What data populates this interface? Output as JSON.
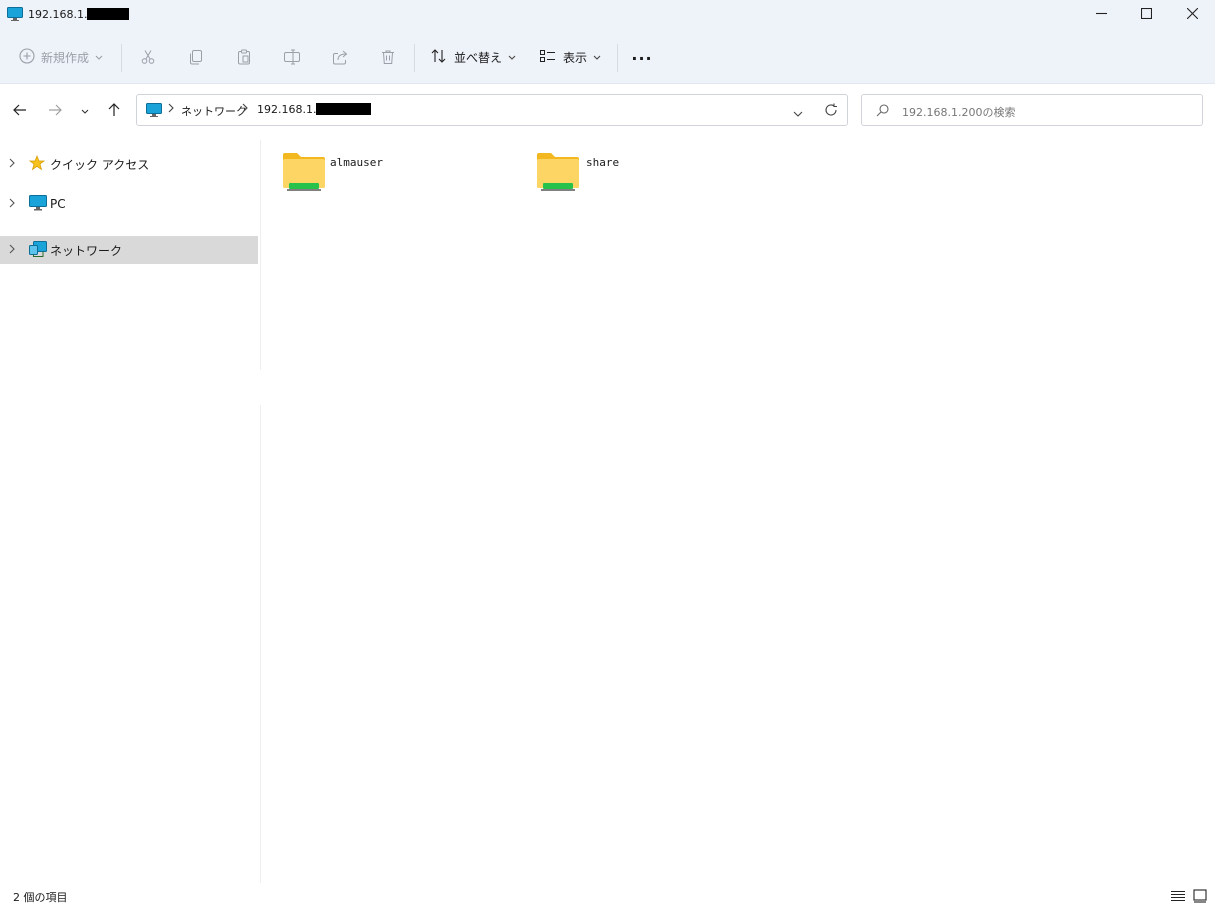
{
  "window": {
    "title": "192.168.1.",
    "minimize_icon": "minimize-icon",
    "maximize_icon": "maximize-icon",
    "close_icon": "close-icon"
  },
  "toolbar": {
    "new_label": "新規作成",
    "sort_label": "並べ替え",
    "view_label": "表示",
    "more_label": "···"
  },
  "nav": {
    "breadcrumb": [
      "ネットワーク",
      "192.168.1."
    ],
    "search_placeholder": "192.168.1.200の検索"
  },
  "sidebar": {
    "items": [
      {
        "label": "クイック アクセス",
        "icon": "star-icon"
      },
      {
        "label": "PC",
        "icon": "pc-icon"
      },
      {
        "label": "ネットワーク",
        "icon": "network-icon",
        "selected": true
      }
    ]
  },
  "content": {
    "folders": [
      {
        "name": "almauser",
        "icon": "shared-folder-icon"
      },
      {
        "name": "share",
        "icon": "shared-folder-icon"
      }
    ]
  },
  "status": {
    "item_count": "2 個の項目"
  },
  "colors": {
    "accent": "#1aa3d9",
    "folder": "#f6c445",
    "folder_share": "#27c24c",
    "selected_bg": "#d9d9d9"
  }
}
